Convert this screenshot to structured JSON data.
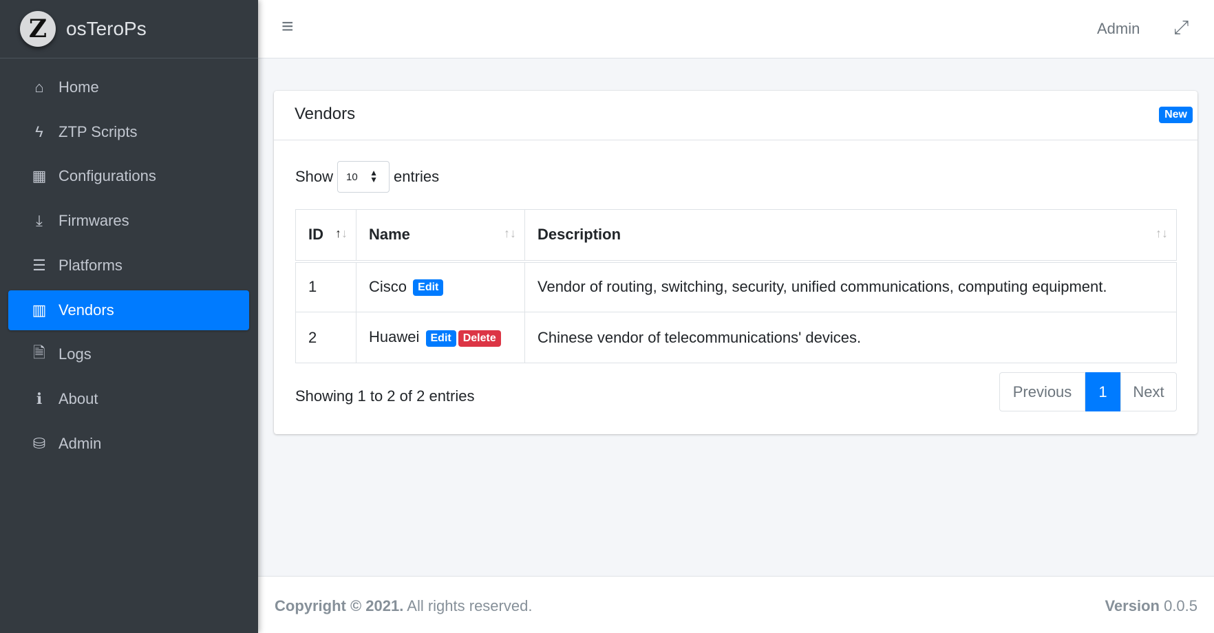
{
  "brand": {
    "logo_letter": "Z",
    "name": "osTeroPs"
  },
  "sidebar": {
    "items": [
      {
        "label": "Home",
        "icon": "home-icon",
        "glyph": "⌂"
      },
      {
        "label": "ZTP Scripts",
        "icon": "bolt-icon",
        "glyph": "ϟ"
      },
      {
        "label": "Configurations",
        "icon": "table-icon",
        "glyph": "▦"
      },
      {
        "label": "Firmwares",
        "icon": "download-icon",
        "glyph": "⤓"
      },
      {
        "label": "Platforms",
        "icon": "server-icon",
        "glyph": "☰"
      },
      {
        "label": "Vendors",
        "icon": "building-icon",
        "glyph": "▥",
        "active": true
      },
      {
        "label": "Logs",
        "icon": "file-icon",
        "glyph": "🗎"
      },
      {
        "label": "About",
        "icon": "info-icon",
        "glyph": "ℹ"
      },
      {
        "label": "Admin",
        "icon": "database-icon",
        "glyph": "⛁"
      }
    ]
  },
  "header": {
    "menu_glyph": "≡",
    "admin_label": "Admin",
    "expand_glyph": "⤢"
  },
  "card": {
    "title": "Vendors",
    "new_label": "New",
    "show_label": "Show",
    "entries_label": "entries",
    "page_size": "10",
    "columns": [
      "ID",
      "Name",
      "Description"
    ],
    "rows": [
      {
        "id": "1",
        "name": "Cisco",
        "actions": [
          "Edit"
        ],
        "description": "Vendor of routing, switching, security, unified communications, computing equipment."
      },
      {
        "id": "2",
        "name": "Huawei",
        "actions": [
          "Edit",
          "Delete"
        ],
        "description": "Chinese vendor of telecommunications' devices."
      }
    ],
    "info": "Showing 1 to 2 of 2 entries",
    "pagination": {
      "previous": "Previous",
      "current": "1",
      "next": "Next"
    }
  },
  "footer": {
    "copyright_bold": "Copyright © 2021.",
    "copyright_rest": " All rights reserved.",
    "version_label": "Version",
    "version": " 0.0.5"
  },
  "colors": {
    "primary": "#007bff",
    "danger": "#dc3545",
    "sidebar": "#343a40"
  }
}
